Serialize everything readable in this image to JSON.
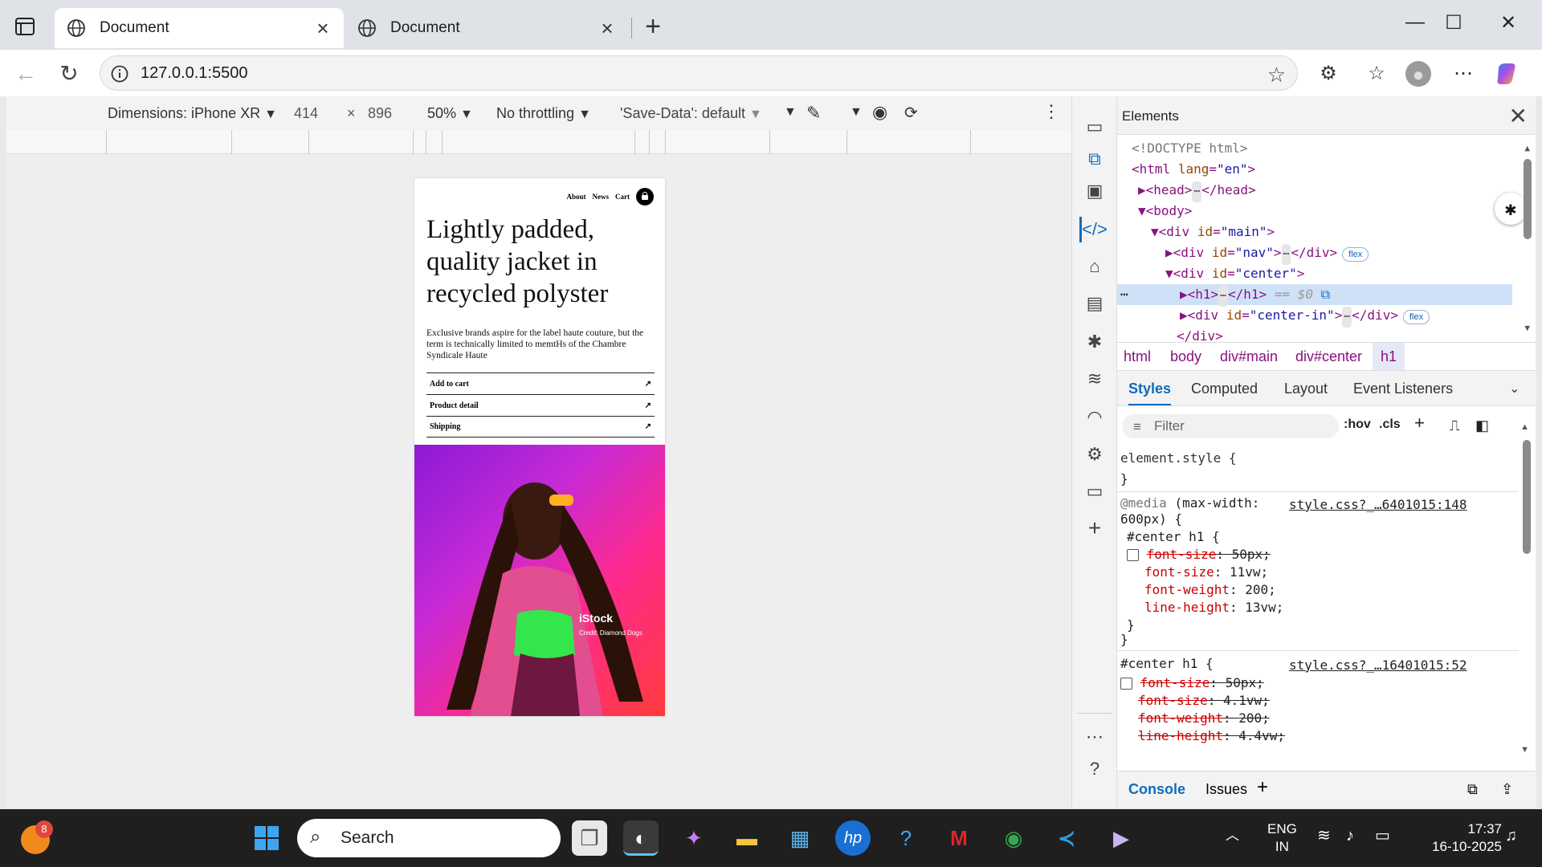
{
  "browser": {
    "tabs": [
      {
        "title": "Document"
      },
      {
        "title": "Document"
      }
    ],
    "url": "127.0.0.1:5500"
  },
  "device_toolbar": {
    "dimensions_label": "Dimensions: iPhone XR",
    "width": "414",
    "times": "×",
    "height": "896",
    "zoom": "50%",
    "throttling": "No throttling",
    "save_data": "'Save-Data': default"
  },
  "page": {
    "nav": [
      "About",
      "News",
      "Cart"
    ],
    "heading": "Lightly padded, quality jacket in recycled polyster",
    "description": "Exclusive brands aspire for the label haute couture, but the term is technically limited to memtHs of the Chambre Syndicale Haute",
    "links": [
      "Add to cart",
      "Product detail",
      "Shipping"
    ],
    "image_watermark": "iStock",
    "image_credit": "Credit: Diamond Dogs"
  },
  "devtools": {
    "panel_title": "Elements",
    "dom": {
      "doctype": "<!DOCTYPE html>",
      "html_open": "<html",
      "lang_attr": "lang",
      "lang_val": "\"en\"",
      "head": "<head>",
      "head_close": "</head>",
      "body": "<body>",
      "div_main": "<div",
      "id_attr": "id",
      "main_val": "\"main\"",
      "nav_val": "\"nav\"",
      "center_val": "\"center\"",
      "center_in_val": "\"center-in\"",
      "div_close": "</div>",
      "h1_open": "<h1>",
      "h1_close": "</h1>",
      "eq_ref": "== $0",
      "badge": "flex"
    },
    "breadcrumbs": [
      "html",
      "body",
      "div#main",
      "div#center",
      "h1"
    ],
    "subtabs": [
      "Styles",
      "Computed",
      "Layout",
      "Event Listeners"
    ],
    "filter_placeholder": "Filter",
    "filter_opts": [
      ":hov",
      ".cls"
    ],
    "styles": {
      "element_style": "element.style {",
      "close_brace": "}",
      "media": "@media",
      "media_query": "(max-width:",
      "media_query2": "600px) {",
      "src1": "style.css?_…6401015:148",
      "selector": "#center h1 {",
      "rule1": [
        {
          "prop": "font-size",
          "val": "50px;",
          "struck": true
        },
        {
          "prop": "font-size",
          "val": "11vw;",
          "struck": false
        },
        {
          "prop": "font-weight",
          "val": "200;",
          "struck": false
        },
        {
          "prop": "line-height",
          "val": "13vw;",
          "struck": false
        }
      ],
      "src2": "style.css?_…16401015:52",
      "rule2": [
        {
          "prop": "font-size",
          "val": "50px;",
          "struck": true
        },
        {
          "prop": "font-size",
          "val": "4.1vw;",
          "struck": true
        },
        {
          "prop": "font-weight",
          "val": "200;",
          "struck": true
        },
        {
          "prop": "line-height",
          "val": "4.4vw;",
          "struck": true
        }
      ]
    },
    "drawer_tabs": [
      "Console",
      "Issues"
    ]
  },
  "taskbar": {
    "search_placeholder": "Search",
    "notification_count": "8",
    "lang_line1": "ENG",
    "lang_line2": "IN",
    "time": "17:37",
    "date": "16-10-2025"
  }
}
